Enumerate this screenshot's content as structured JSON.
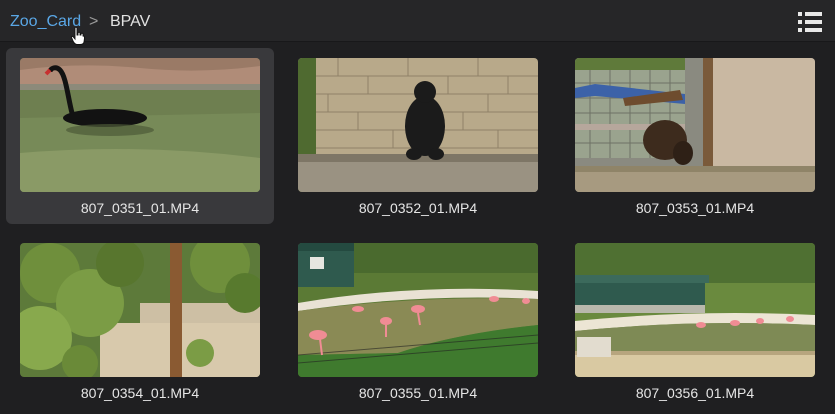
{
  "breadcrumb": {
    "root": "Zoo_Card",
    "separator": ">",
    "current": "BPAV"
  },
  "toolbar": {
    "view_toggle_icon": "list-view-icon"
  },
  "clips": [
    {
      "name": "807_0351_01.MP4",
      "subject": "black swan in pond",
      "selected": true
    },
    {
      "name": "807_0352_01.MP4",
      "subject": "bear standing by stone wall",
      "selected": false
    },
    {
      "name": "807_0353_01.MP4",
      "subject": "bison by wooden shelter",
      "selected": false
    },
    {
      "name": "807_0354_01.MP4",
      "subject": "trees and foliage",
      "selected": false
    },
    {
      "name": "807_0355_01.MP4",
      "subject": "flamingos in pond",
      "selected": false
    },
    {
      "name": "807_0356_01.MP4",
      "subject": "flamingo pond with building",
      "selected": false
    }
  ],
  "colors": {
    "background": "#1f1f21",
    "topbar": "#262628",
    "link": "#5aa7e6",
    "selected_tile": "#39393c",
    "text": "#e6e6e6"
  }
}
